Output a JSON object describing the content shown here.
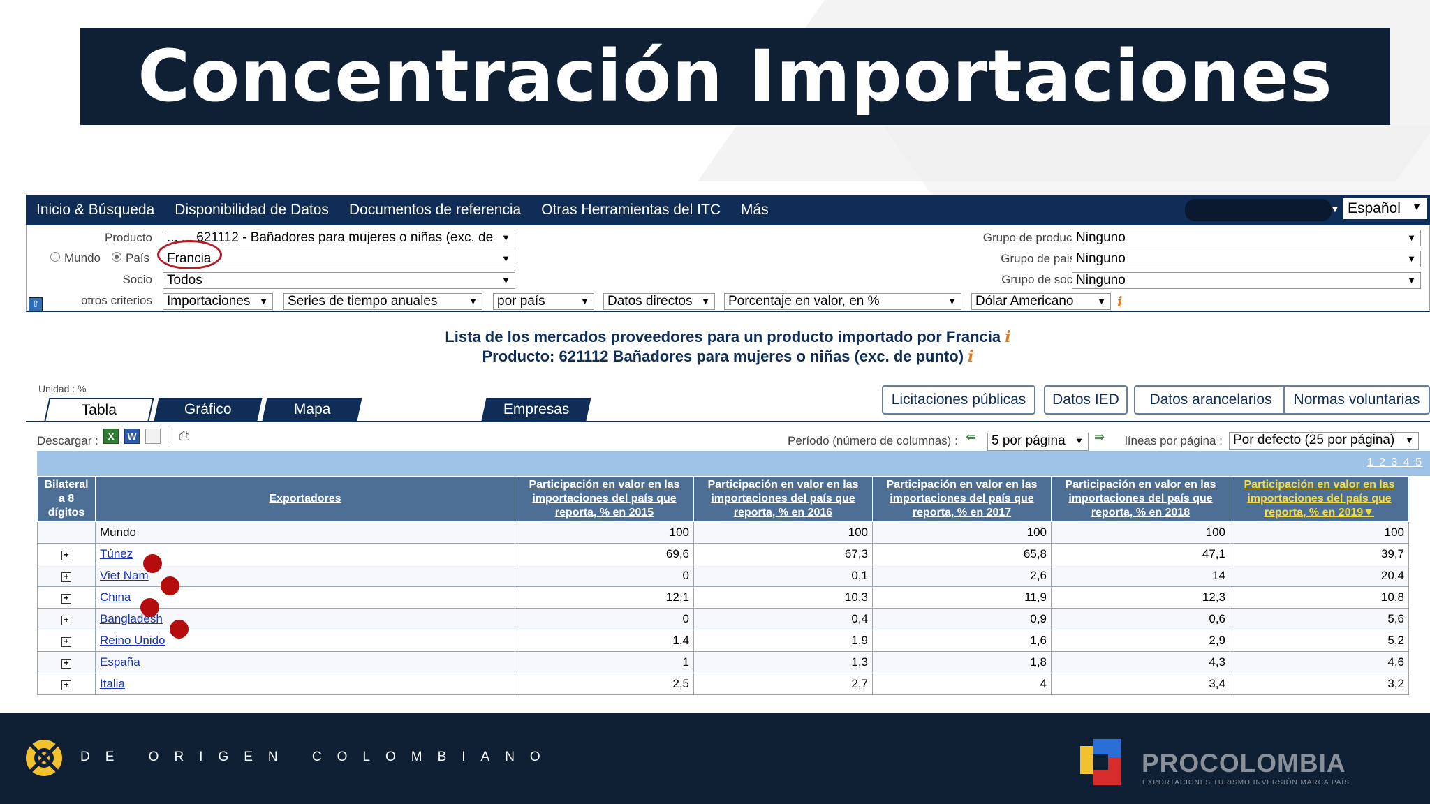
{
  "slide": {
    "title": "Concentración Importaciones"
  },
  "menubar": {
    "items": [
      "Inicio & Búsqueda",
      "Disponibilidad de Datos",
      "Documentos de referencia",
      "Otras Herramientas del ITC",
      "Más"
    ],
    "language": "Español"
  },
  "criteria": {
    "producto_label": "Producto",
    "producto_value": "... ... 621112 - Bañadores para mujeres o niñas (exc. de",
    "mundo_label": "Mundo",
    "pais_label": "País",
    "pais_value": "Francia",
    "socio_label": "Socio",
    "socio_value": "Todos",
    "otros_label": "otros criterios",
    "otros": [
      "Importaciones",
      "Series de tiempo anuales",
      "por país",
      "Datos directos",
      "Porcentaje en valor, en %",
      "Dólar Americano"
    ],
    "grupo_productos_label": "Grupo de productos",
    "grupo_productos_value": "Ninguno",
    "grupo_paises_label": "Grupo de paises",
    "grupo_paises_value": "Ninguno",
    "grupo_socios_label": "Grupo de socios",
    "grupo_socios_value": "Ninguno",
    "info_glyph": "i"
  },
  "report": {
    "title_line1": "Lista de los mercados proveedores para un producto importado por Francia",
    "title_line2": "Producto: 621112 Bañadores para mujeres o niñas (exc. de punto)",
    "unidad": "Unidad : %"
  },
  "tabs": [
    "Tabla",
    "Gráfico",
    "Mapa",
    "Empresas"
  ],
  "right_buttons": [
    "Licitaciones públicas",
    "Datos IED",
    "Datos arancelarios",
    "Normas voluntarias"
  ],
  "toolbar": {
    "descargar": "Descargar :",
    "periodo_label": "Período (número de columnas) :",
    "periodo_value": "5 por página",
    "lineas_label": "líneas por página :",
    "lineas_value": "Por defecto (25 por página)",
    "pages": "1 2 3 4 5"
  },
  "table": {
    "headers": [
      "Bilateral a 8 dígitos",
      "Exportadores",
      "Participación en valor en las importaciones del país que reporta, % en 2015",
      "Participación en valor en las importaciones del país que reporta, % en 2016",
      "Participación en valor en las importaciones del país que reporta, % en 2017",
      "Participación en valor en las importaciones del país que reporta, % en 2018",
      "Participación en valor en las importaciones del país que reporta, % en 2019▼"
    ],
    "rows": [
      {
        "name": "Mundo",
        "link": false,
        "values": [
          "100",
          "100",
          "100",
          "100",
          "100"
        ]
      },
      {
        "name": "Túnez",
        "link": true,
        "values": [
          "69,6",
          "67,3",
          "65,8",
          "47,1",
          "39,7"
        ]
      },
      {
        "name": "Viet Nam",
        "link": true,
        "values": [
          "0",
          "0,1",
          "2,6",
          "14",
          "20,4"
        ]
      },
      {
        "name": "China",
        "link": true,
        "values": [
          "12,1",
          "10,3",
          "11,9",
          "12,3",
          "10,8"
        ]
      },
      {
        "name": "Bangladesh",
        "link": true,
        "values": [
          "0",
          "0,4",
          "0,9",
          "0,6",
          "5,6"
        ]
      },
      {
        "name": "Reino Unido",
        "link": true,
        "values": [
          "1,4",
          "1,9",
          "1,6",
          "2,9",
          "5,2"
        ]
      },
      {
        "name": "España",
        "link": true,
        "values": [
          "1",
          "1,3",
          "1,8",
          "4,3",
          "4,6"
        ]
      },
      {
        "name": "Italia",
        "link": true,
        "values": [
          "2,5",
          "2,7",
          "4",
          "3,4",
          "3,2"
        ]
      }
    ]
  },
  "footer": {
    "tagline": "DE ORIGEN COLOMBIANO",
    "brand": "PROCOLOMBIA",
    "brand_sub": "EXPORTACIONES TURISMO INVERSIÓN MARCA PAÍS"
  },
  "colors": {
    "navy": "#0f2034",
    "menu_blue": "#0f2d57",
    "header_blue": "#4d6f96",
    "highlight_red": "#b50d0d",
    "sorted_yellow": "#f5dc3c"
  }
}
